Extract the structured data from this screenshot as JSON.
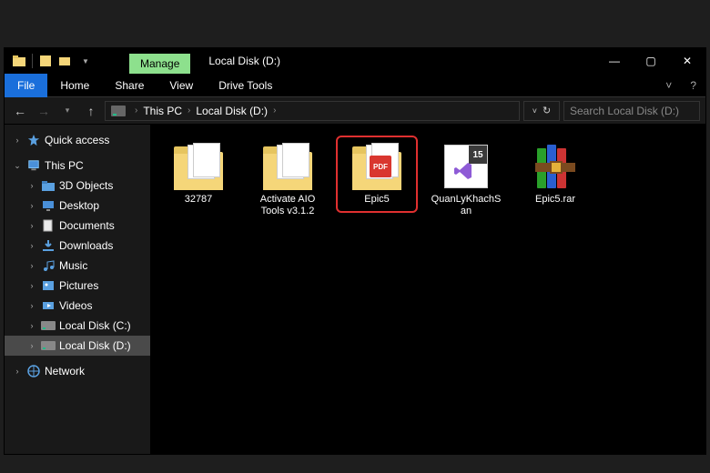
{
  "titlebar": {
    "context_tab": "Manage",
    "window_title": "Local Disk (D:)"
  },
  "ribbon": {
    "file": "File",
    "tabs": [
      "Home",
      "Share",
      "View",
      "Drive Tools"
    ]
  },
  "address": {
    "crumbs": [
      "This PC",
      "Local Disk (D:)"
    ],
    "search_placeholder": "Search Local Disk (D:)"
  },
  "nav": {
    "quick_access": "Quick access",
    "this_pc": "This PC",
    "children": [
      "3D Objects",
      "Desktop",
      "Documents",
      "Downloads",
      "Music",
      "Pictures",
      "Videos",
      "Local Disk (C:)",
      "Local Disk (D:)"
    ],
    "network": "Network"
  },
  "items": [
    {
      "label": "32787",
      "type": "folder"
    },
    {
      "label": "Activate AIO Tools v3.1.2",
      "type": "folder"
    },
    {
      "label": "Epic5",
      "type": "folder-pdf",
      "highlighted": true
    },
    {
      "label": "QuanLyKhachSan",
      "type": "vs"
    },
    {
      "label": "Epic5.rar",
      "type": "rar"
    }
  ]
}
